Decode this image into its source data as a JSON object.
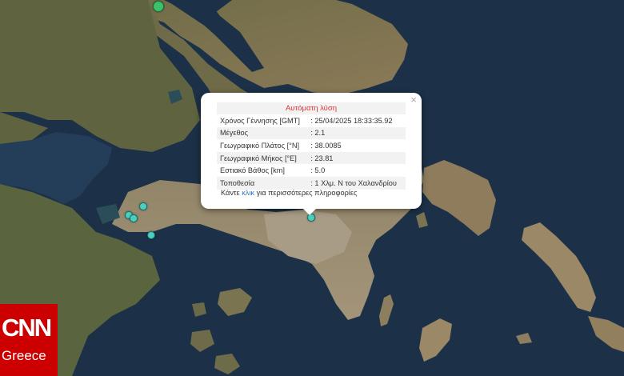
{
  "popup": {
    "title": "Αυτόματη λύση",
    "close_glyph": "×",
    "rows": [
      {
        "label": "Χρόνος Γέννησης [GMT]",
        "value": ": 25/04/2025 18:33:35.92"
      },
      {
        "label": "Μέγεθος",
        "value": ": 2.1"
      },
      {
        "label": "Γεωγραφικό Πλάτος [°N]",
        "value": ": 38.0085"
      },
      {
        "label": "Γεωγραφικό Μήκος [°E]",
        "value": ": 23.81"
      },
      {
        "label": "Εστιακό Βάθος [km]",
        "value": ": 5.0"
      },
      {
        "label": "Τοποθεσία",
        "value": ": 1 Χλμ. Ν του Χαλανδρίου"
      }
    ],
    "more_prefix": "Κάντε ",
    "more_link": "κλικ",
    "more_suffix": " για περισσότερες πληροφορίες"
  },
  "logo": {
    "line1": "CNN",
    "line2": "Greece",
    "color": "#cc0000"
  },
  "colors": {
    "sea": "#1c3147",
    "land_dark": "#4f5b34",
    "land_light": "#8a7a5a",
    "marker": "#4ad0c0",
    "marker_big": "#3cc06a"
  }
}
